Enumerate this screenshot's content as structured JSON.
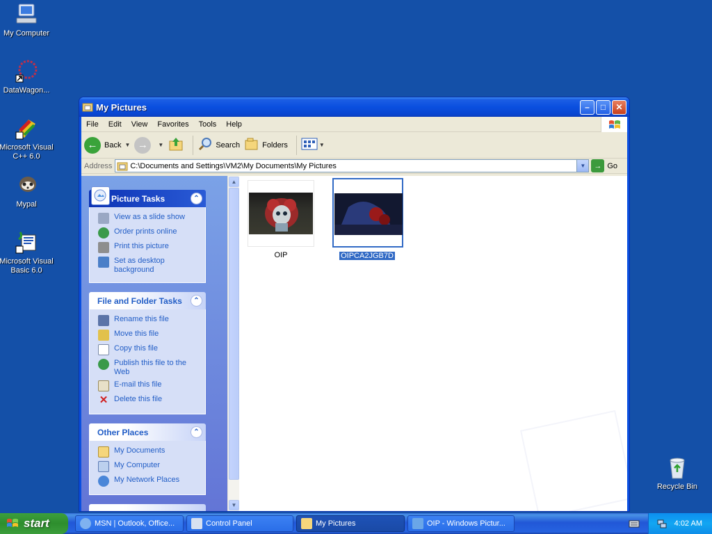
{
  "desktop": {
    "icons": [
      {
        "label": "My Computer",
        "icon": "my-computer-icon"
      },
      {
        "label": "DataWagon...",
        "icon": "datawagon-icon"
      },
      {
        "label": "Microsoft Visual C++ 6.0",
        "icon": "visual-cpp-icon"
      },
      {
        "label": "Mypal",
        "icon": "mypal-icon"
      },
      {
        "label": "Microsoft Visual Basic 6.0",
        "icon": "visual-basic-icon"
      },
      {
        "label": "Recycle Bin",
        "icon": "recycle-bin-icon"
      }
    ]
  },
  "window": {
    "title": "My Pictures",
    "menu": [
      "File",
      "Edit",
      "View",
      "Favorites",
      "Tools",
      "Help"
    ],
    "toolbar": {
      "back": "Back",
      "search": "Search",
      "folders": "Folders"
    },
    "address": {
      "label": "Address",
      "value": "C:\\Documents and Settings\\VM2\\My Documents\\My Pictures",
      "go": "Go"
    },
    "task_panes": [
      {
        "title": "Picture Tasks",
        "items": [
          "View as a slide show",
          "Order prints online",
          "Print this picture",
          "Set as desktop background"
        ]
      },
      {
        "title": "File and Folder Tasks",
        "items": [
          "Rename this file",
          "Move this file",
          "Copy this file",
          "Publish this file to the Web",
          "E-mail this file",
          "Delete this file"
        ]
      },
      {
        "title": "Other Places",
        "items": [
          "My Documents",
          "My Computer",
          "My Network Places"
        ]
      }
    ],
    "files": [
      {
        "name": "OIP",
        "selected": false
      },
      {
        "name": "OIPCA2JGB7D",
        "selected": true
      }
    ]
  },
  "taskbar": {
    "start": "start",
    "buttons": [
      {
        "label": "MSN | Outlook, Office...",
        "active": false
      },
      {
        "label": "Control Panel",
        "active": false
      },
      {
        "label": "My Pictures",
        "active": true
      },
      {
        "label": "OIP - Windows Pictur...",
        "active": false
      }
    ],
    "clock": "4:02 AM"
  },
  "colors": {
    "desktop": "#1450a8",
    "title_blue": "#0a4fdf",
    "selection": "#316ac5",
    "task_link": "#215dc6"
  }
}
